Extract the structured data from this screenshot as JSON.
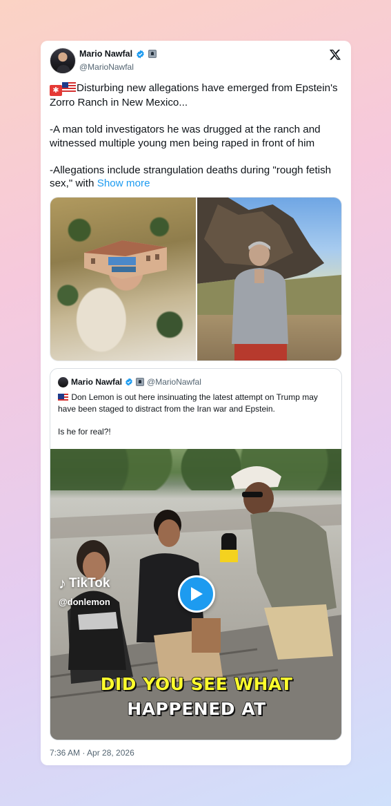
{
  "tweet": {
    "author_name": "Mario Nawfal",
    "handle": "@MarioNawfal",
    "body_main": "Disturbing new allegations have emerged from Epstein's Zorro Ranch in New Mexico...\n\n-A man told investigators he was drugged at the ranch and witnessed multiple young men being raped in front of him\n\n-Allegations include strangulation deaths during \"rough fetish sex,\" with ",
    "show_more": "Show more",
    "timestamp": "7:36 AM · Apr 28, 2026"
  },
  "quote": {
    "author_name": "Mario Nawfal",
    "handle": "@MarioNawfal",
    "body": "Don Lemon is out here insinuating the latest attempt on Trump may have been staged to distract from the Iran war and Epstein.\n\nIs he for real?!"
  },
  "video": {
    "watermark": "TikTok",
    "watermark_handle": "@donlemon",
    "mic_label": "DL",
    "caption_line1": "DID YOU SEE WHAT",
    "caption_line2": "HAPPENED AT"
  },
  "icons": {
    "verified": "verified-badge-icon",
    "affiliate": "affiliate-badge-icon",
    "platform": "x-logo-icon",
    "play": "play-icon"
  },
  "colors": {
    "link": "#1d9bf0",
    "caption_yellow": "#ffff2d",
    "verified_blue": "#1d9bf0"
  }
}
